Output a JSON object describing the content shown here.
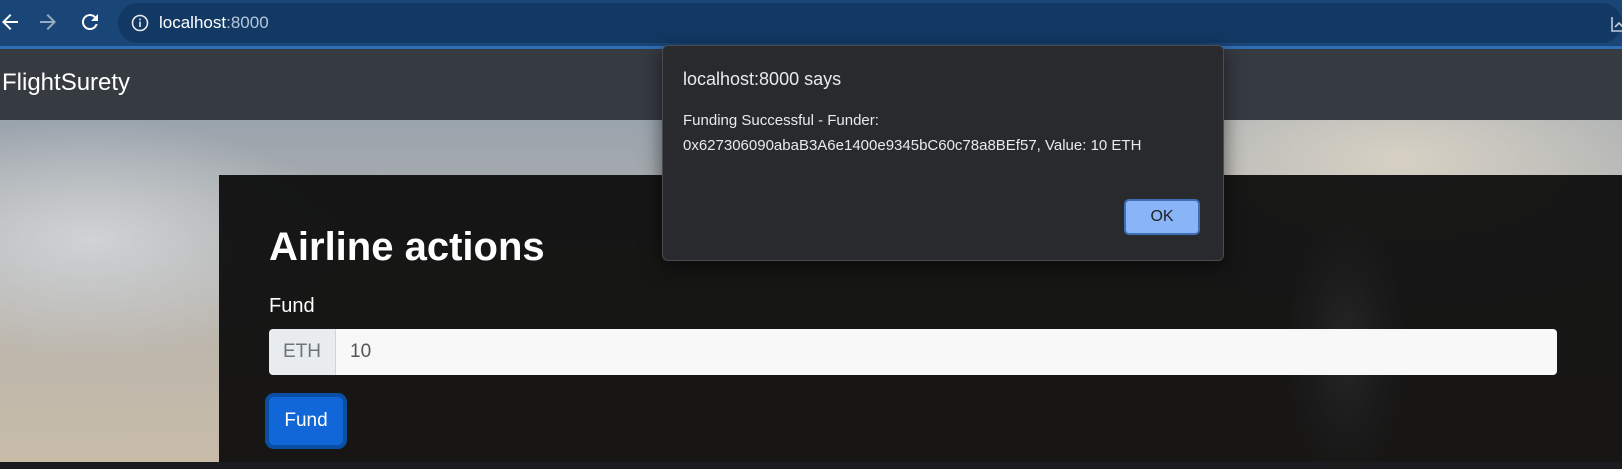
{
  "browser": {
    "url_host": "localhost",
    "url_port": ":8000"
  },
  "navbar": {
    "brand": "FlightSurety"
  },
  "airline": {
    "title": "Airline actions",
    "fund_label": "Fund",
    "currency_addon": "ETH",
    "amount_value": "10",
    "fund_button": "Fund"
  },
  "dialog": {
    "title": "localhost:8000 says",
    "message_line1": "Funding Successful - Funder:",
    "message_line2": "0x627306090abaB3A6e1400e9345bC60c78a8BEf57, Value: 10 ETH",
    "ok_button": "OK"
  },
  "colors": {
    "browser_bar": "#1a4677",
    "accent": "#0d6efd",
    "dialog_button": "#8ab4f8"
  }
}
